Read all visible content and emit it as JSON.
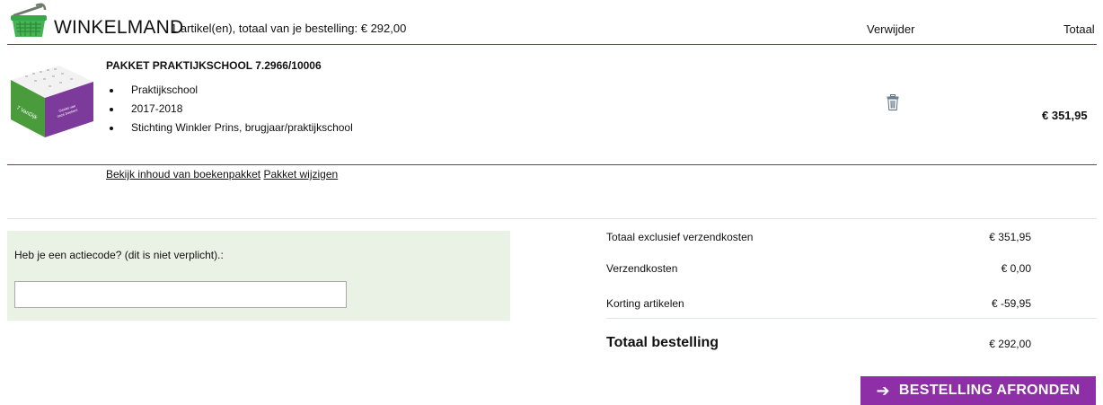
{
  "header": {
    "title": "WINKELMAND",
    "subtitle": "1 artikel(en), totaal van je bestelling: € 292,00",
    "col_remove": "Verwijder",
    "col_total": "Totaal"
  },
  "product": {
    "name": "PAKKET PRAKTIJKSCHOOL 7.2966/10006",
    "details": [
      "Praktijkschool",
      "2017-2018",
      "Stichting Winkler Prins, brugjaar/praktijkschool"
    ],
    "link_view": "Bekijk inhoud van boekenpakket",
    "link_edit": "Pakket wijzigen",
    "price": "€ 351,95",
    "remove_icon": "trash-icon"
  },
  "coupon": {
    "label": "Heb je een actiecode? (dit is niet verplicht).:",
    "value": "",
    "placeholder": ""
  },
  "totals": {
    "excl_label": "Totaal exclusief verzendkosten",
    "excl_value": "€ 351,95",
    "shipping_label": "Verzendkosten",
    "shipping_value": "€ 0,00",
    "discount_label": "Korting artikelen",
    "discount_value": "€ -59,95",
    "order_label": "Totaal bestelling",
    "order_value": "€ 292,00"
  },
  "checkout": {
    "label": "BESTELLING AFRONDEN",
    "icon": "arrow-right-icon"
  },
  "colors": {
    "accent": "#8e2fa8",
    "divider": "#7b2d8e",
    "basket": "#3aa64a",
    "coupon_bg": "#eaf2e6"
  }
}
